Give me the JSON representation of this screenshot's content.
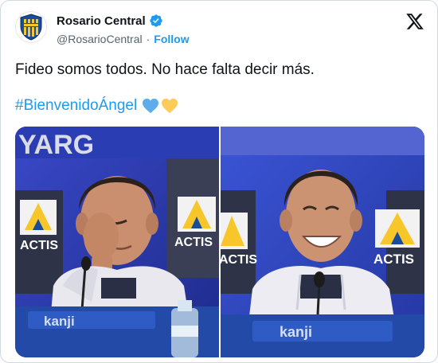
{
  "author": {
    "display_name": "Rosario Central",
    "handle": "@RosarioCentral",
    "separator": "·",
    "follow_label": "Follow",
    "avatar_icon": "rosario-central-crest",
    "verified_icon": "verified-badge-icon"
  },
  "tweet": {
    "text": "Fideo somos todos. No hace falta decir más.",
    "hashtag": "#BienvenidoÁngel",
    "emojis": [
      "blue-heart",
      "yellow-heart"
    ]
  },
  "media": {
    "photos": [
      {
        "name": "photo-crying-press-conference",
        "sponsor_text": "ACTIS",
        "desk_text": "kanji",
        "banner_text": "YARG"
      },
      {
        "name": "photo-smiling-press-conference",
        "sponsor_text": "ACTIS",
        "desk_text": "kanji"
      }
    ]
  },
  "colors": {
    "link": "#1d9bf0",
    "muted": "#536471",
    "text": "#0f1419",
    "border": "#cfd9de",
    "brand_blue": "#1a4c9c",
    "brand_yellow": "#f6c62a"
  }
}
